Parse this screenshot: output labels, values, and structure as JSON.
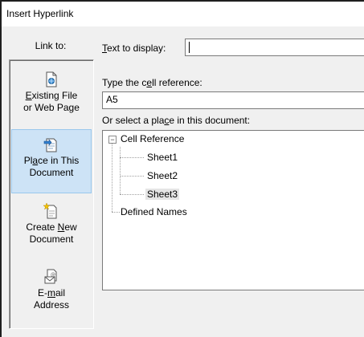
{
  "dialog": {
    "title": "Insert Hyperlink",
    "link_to_label": "Link to:"
  },
  "sidebar": {
    "items": [
      {
        "pre": "",
        "u": "E",
        "post": "xisting File\nor Web Page",
        "icon": "existing-file-icon"
      },
      {
        "pre": "Pl",
        "u": "a",
        "post": "ce in This\nDocument",
        "icon": "place-in-document-icon"
      },
      {
        "pre": "Create ",
        "u": "N",
        "post": "ew\nDocument",
        "icon": "new-document-icon"
      },
      {
        "pre": "E-",
        "u": "m",
        "post": "ail\nAddress",
        "icon": "email-icon"
      }
    ]
  },
  "main": {
    "text_to_display": {
      "u": "T",
      "rest": "ext to display:",
      "value": ""
    },
    "cell_ref": {
      "pre": "Type the c",
      "u": "e",
      "post": "ll reference:",
      "value": "A5"
    },
    "place": {
      "pre": "Or select a pla",
      "u": "c",
      "post": "e in this document:"
    },
    "tree": {
      "root": "Cell Reference",
      "expander": "−",
      "children": [
        "Sheet1",
        "Sheet2",
        "Sheet3"
      ],
      "selected": "Sheet3",
      "defined_names": "Defined Names"
    }
  }
}
